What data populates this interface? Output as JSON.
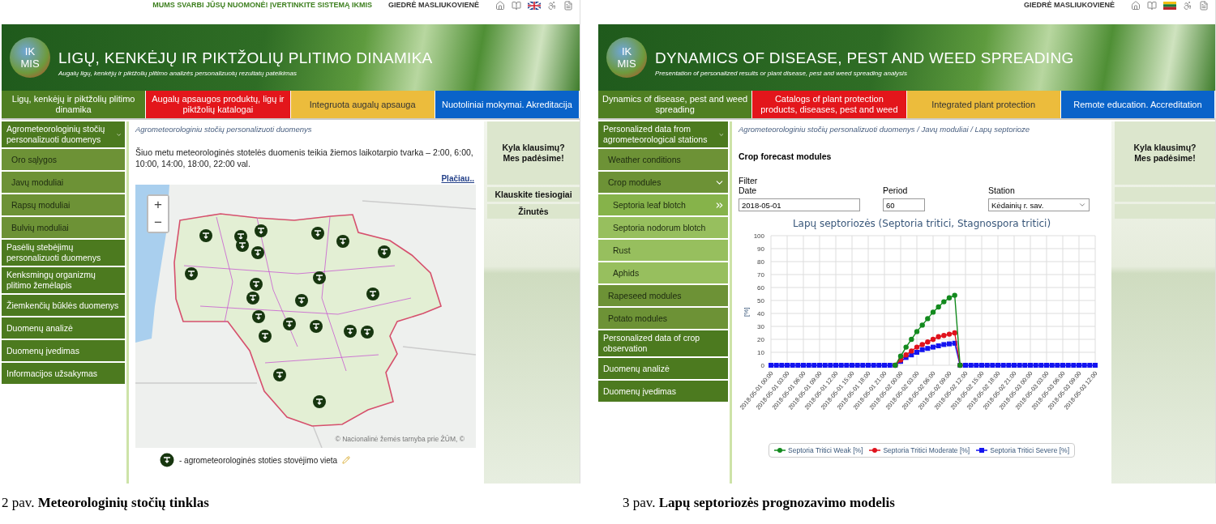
{
  "figures": [
    {
      "top_bar": {
        "notice": "MUMS SVARBI JŪSŲ NUOMONĖ! ĮVERTINKITE SISTEMĄ IKMIS",
        "user": "GIEDRĖ MASLIUKOVIENĖ"
      },
      "banner": {
        "logo_top": "IK",
        "logo_bottom": "MIS",
        "title": "LIGŲ, KENKĖJŲ IR PIKTŽOLIŲ PLITIMO DINAMIKA",
        "subtitle": "Augalų ligų, kenkėjų ir piktžolių plitimo analizės personalizuotų rezultatų pateikimas"
      },
      "tabs": [
        {
          "label": "Ligų, kenkėjų ir piktžolių plitimo dinamika",
          "color": "#4f7f22"
        },
        {
          "label": "Augalų apsaugos produktų, ligų ir piktžolių katalogai",
          "color": "#e3161b"
        },
        {
          "label": "Integruota augalų apsauga",
          "color": "#ecbc3c"
        },
        {
          "label": "Nuotoliniai mokymai. Akreditacija",
          "color": "#0a63c9"
        }
      ],
      "sidebar": [
        {
          "label": "Agrometeorologinių stočių personalizuoti duomenys",
          "selected": false,
          "expanded": true,
          "children": [
            {
              "label": "Oro sąlygos",
              "selected": false
            },
            {
              "label": "Javų moduliai",
              "selected": false
            },
            {
              "label": "Rapsų moduliai",
              "selected": false
            },
            {
              "label": "Bulvių moduliai",
              "selected": false
            }
          ]
        },
        {
          "label": "Pasėlių stebėjimų personalizuoti duomenys",
          "selected": false
        },
        {
          "label": "Kenksmingų organizmų plitimo žemėlapis",
          "selected": false
        },
        {
          "label": "Žiemkenčių būklės duomenys",
          "selected": false
        },
        {
          "label": "Duomenų analizė",
          "selected": false
        },
        {
          "label": "Duomenų įvedimas",
          "selected": false
        },
        {
          "label": "Informacijos užsakymas",
          "selected": false
        }
      ],
      "main": {
        "kind": "map",
        "breadcrumb": "Agrometeorologiniu stočių personalizuoti duomenys",
        "notice": "Šiuo metu meteorologinės stotelės duomenis teikia žiemos laikotarpio tvarka – 2:00, 6:00, 10:00, 14:00, 18:00, 22:00 val.",
        "more_link": "Plačiau..",
        "zoom_in": "+",
        "zoom_out": "−",
        "attribution": "© Nacionalinė žemės tarnyba prie ŽŪM, ©",
        "legend": "- agrometeorologinės stoties stovėjimo vieta"
      },
      "help": {
        "lines": [
          "Kyla klausimų?",
          "Mes padėsime!"
        ],
        "links": [
          "Klauskite tiesiogiai",
          "Žinutės"
        ]
      },
      "caption": "2 pav. **Meteorologinių stočių tinklas**"
    },
    {
      "top_bar": {
        "user": "GIEDRĖ MASLIUKOVIENĖ"
      },
      "banner": {
        "logo_top": "IK",
        "logo_bottom": "MIS",
        "title": "DYNAMICS OF DISEASE, PEST AND WEED SPREADING",
        "subtitle": "Presentation of personalized results or plant disease, pest and weed spreading analysis"
      },
      "tabs": [
        {
          "label": "Dynamics of disease, pest and weed spreading",
          "color": "#4f7f22"
        },
        {
          "label": "Catalogs of plant protection products, diseases, pest and weed",
          "color": "#e3161b"
        },
        {
          "label": "Integrated plant protection",
          "color": "#ecbc3c"
        },
        {
          "label": "Remote education. Accreditation",
          "color": "#0a63c9"
        }
      ],
      "sidebar": [
        {
          "label": "Personalized data from agrometeorological stations",
          "selected": false,
          "expanded": true,
          "children": [
            {
              "label": "Weather conditions",
              "selected": false
            },
            {
              "label": "Crop modules",
              "selected": false,
              "expanded": true,
              "children": [
                {
                  "label": "Septoria leaf blotch",
                  "selected": true
                },
                {
                  "label": "Septoria nodorum blotch",
                  "selected": false
                },
                {
                  "label": "Rust",
                  "selected": false
                },
                {
                  "label": "Aphids",
                  "selected": false
                }
              ]
            },
            {
              "label": "Rapeseed modules",
              "selected": false
            },
            {
              "label": "Potato modules",
              "selected": false
            }
          ]
        },
        {
          "label": "Personalized data of crop observation",
          "selected": false
        },
        {
          "label": "Duomenų analizė",
          "selected": false
        },
        {
          "label": "Duomenų įvedimas",
          "selected": false
        }
      ],
      "main": {
        "kind": "chart",
        "breadcrumb": "Agrometeorologiniu stočių personalizuoti duomenys / Javų moduliai / Lapų septorioze",
        "heading": "Crop forecast modules",
        "filter_label": "Filter",
        "fields": [
          {
            "label": "Date",
            "value": "2018-05-01",
            "kind": "text"
          },
          {
            "label": "Period",
            "value": "60",
            "kind": "text"
          },
          {
            "label": "Station",
            "value": "Kėdainių r. sav.",
            "kind": "select"
          }
        ],
        "chart_data": {
          "type": "line",
          "title": "Lapų septoriozės (Septoria tritici, Stagnospora tritici)",
          "ylabel": "[%]",
          "grid": true,
          "ylim": [
            0,
            100
          ],
          "yticks": [
            0,
            10,
            20,
            30,
            40,
            50,
            60,
            70,
            80,
            90,
            100
          ],
          "categories": [
            "2018-05-01 00:00",
            null,
            null,
            "2018-05-01 03:00",
            null,
            null,
            "2018-05-01 06:00",
            null,
            null,
            "2018-05-01 09:00",
            null,
            null,
            "2018-05-01 12:00",
            null,
            null,
            "2018-05-01 15:00",
            null,
            null,
            "2018-05-01 18:00",
            null,
            null,
            "2018-05-01 21:00",
            null,
            null,
            "2018-05-02 00:00",
            null,
            null,
            "2018-05-02 03:00",
            null,
            null,
            "2018-05-02 06:00",
            null,
            null,
            "2018-05-02 09:00",
            null,
            null,
            "2018-05-02 12:00",
            null,
            null,
            "2018-05-02 15:00",
            null,
            null,
            "2018-05-02 18:00",
            null,
            null,
            "2018-05-02 21:00",
            null,
            null,
            "2018-05-03 00:00",
            null,
            null,
            "2018-05-03 03:00",
            null,
            null,
            "2018-05-03 06:00",
            null,
            null,
            "2018-05-03 09:00",
            null,
            null,
            "2018-05-03 12:00"
          ],
          "series": [
            {
              "name": "Septoria Tritici Weak [%]",
              "color": "#138a1e",
              "marker": "circle",
              "values": [
                null,
                null,
                null,
                null,
                null,
                null,
                null,
                null,
                null,
                null,
                null,
                null,
                null,
                null,
                null,
                null,
                null,
                null,
                null,
                null,
                null,
                null,
                null,
                0,
                7,
                14,
                20,
                26,
                31,
                36,
                41,
                45,
                49,
                52,
                54,
                0,
                null,
                null,
                null,
                null,
                null,
                null,
                null,
                null,
                null,
                null,
                null,
                null,
                null,
                null,
                null,
                null,
                null,
                null,
                null,
                null,
                null,
                null,
                null,
                null,
                null
              ]
            },
            {
              "name": "Septoria Tritici Moderate [%]",
              "color": "#e0121c",
              "marker": "circle",
              "values": [
                null,
                null,
                null,
                null,
                null,
                null,
                null,
                null,
                null,
                null,
                null,
                null,
                null,
                null,
                null,
                null,
                null,
                null,
                null,
                null,
                null,
                null,
                null,
                0,
                4,
                8,
                11,
                14,
                16,
                18,
                20,
                22,
                23,
                24,
                25,
                0,
                null,
                null,
                null,
                null,
                null,
                null,
                null,
                null,
                null,
                null,
                null,
                null,
                null,
                null,
                null,
                null,
                null,
                null,
                null,
                null,
                null,
                null,
                null,
                null,
                null
              ]
            },
            {
              "name": "Septoria Tritici Severe [%]",
              "color": "#1414f0",
              "marker": "square",
              "values": [
                0,
                0,
                0,
                0,
                0,
                0,
                0,
                0,
                0,
                0,
                0,
                0,
                0,
                0,
                0,
                0,
                0,
                0,
                0,
                0,
                0,
                0,
                0,
                0,
                3,
                6,
                8,
                10,
                12,
                13,
                14,
                15,
                16,
                16.5,
                17,
                0,
                0,
                0,
                0,
                0,
                0,
                0,
                0,
                0,
                0,
                0,
                0,
                0,
                0,
                0,
                0,
                0,
                0,
                0,
                0,
                0,
                0,
                0,
                0,
                0,
                0
              ]
            }
          ]
        }
      },
      "help": {
        "lines": [
          "Kyla klausimų?",
          "Mes padėsime!"
        ]
      },
      "caption": "3 pav. **Lapų septoriozės prognozavimo modelis**"
    }
  ]
}
